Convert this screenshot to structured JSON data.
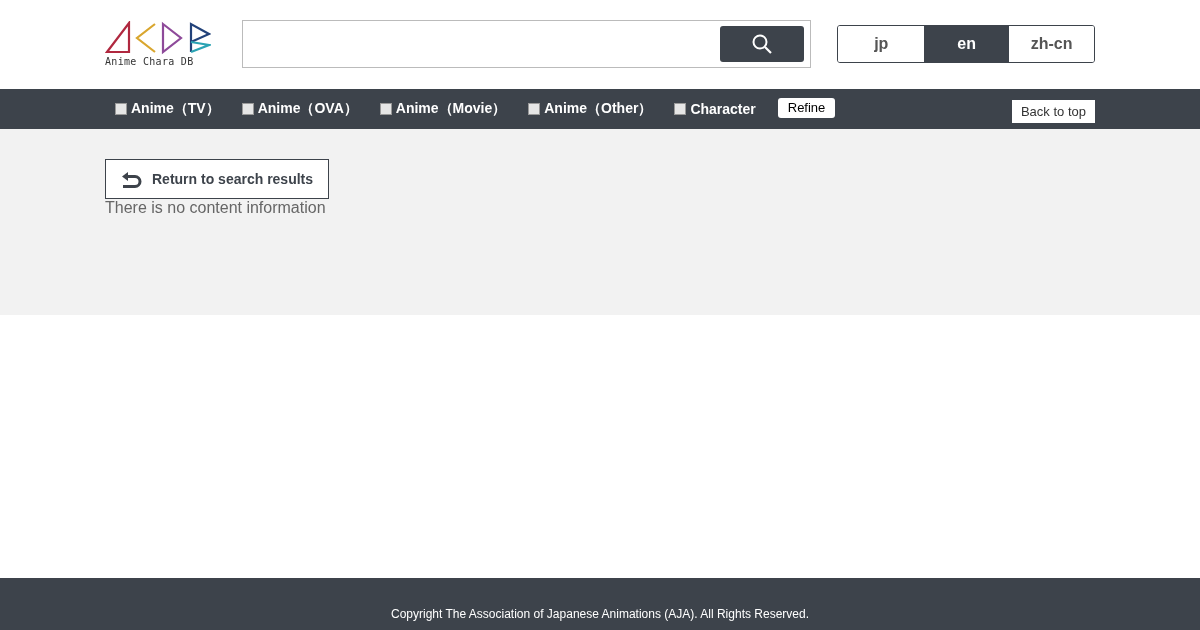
{
  "logo": {
    "text": "Anime Chara DB"
  },
  "languages": [
    {
      "label": "jp",
      "selected": false
    },
    {
      "label": "en",
      "selected": true
    },
    {
      "label": "zh-cn",
      "selected": false
    }
  ],
  "filters": [
    {
      "label": "Anime（TV）",
      "checked": false
    },
    {
      "label": "Anime（OVA）",
      "checked": false
    },
    {
      "label": "Anime（Movie）",
      "checked": false
    },
    {
      "label": "Anime（Other）",
      "checked": false
    },
    {
      "label": "Character",
      "checked": false
    }
  ],
  "refine_button": "Refine",
  "back_to_top": "Back to top",
  "return_button": "Return to search results",
  "message": "There is no content information",
  "footer": "Copyright The Association of Japanese Animations (AJA). All Rights Reserved."
}
